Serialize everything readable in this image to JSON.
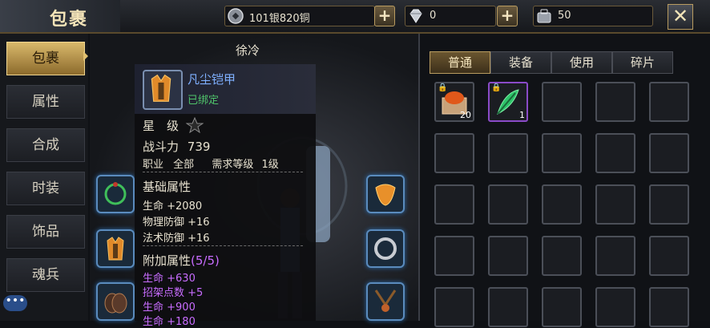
{
  "title": "包裹",
  "resources": [
    {
      "icon": "silver-coin-icon",
      "value": "101银820铜"
    },
    {
      "icon": "diamond-icon",
      "value": "0"
    },
    {
      "icon": "bag-icon",
      "value": "50"
    }
  ],
  "sidebar": {
    "tabs": [
      "包裹",
      "属性",
      "合成",
      "时装",
      "饰品",
      "魂兵"
    ],
    "active": 0
  },
  "character": {
    "name": "徐冷"
  },
  "tooltip": {
    "name": "凡尘铠甲",
    "bound": "已绑定",
    "star_label": "星　级",
    "power_label": "战斗力",
    "power_value": "739",
    "job_label": "职业",
    "job_value": "全部",
    "level_label": "需求等级",
    "level_value": "1级",
    "base_title": "基础属性",
    "base_stats": [
      "生命 +2080",
      "物理防御 +16",
      "法术防御 +16"
    ],
    "extra_title": "附加属性",
    "extra_count": "(5/5)",
    "extra_stats": [
      "生命 +630",
      "招架点数 +5",
      "生命 +900",
      "生命 +180"
    ]
  },
  "rightpanel": {
    "tabs": [
      "普通",
      "装备",
      "使用",
      "碎片"
    ],
    "active": 0,
    "items": [
      {
        "icon": "chest-icon",
        "count": "20",
        "locked": true
      },
      {
        "icon": "feather-icon",
        "count": "1",
        "locked": true
      }
    ]
  },
  "chat_icon": "chat-bubble-icon",
  "colors": {
    "gold": "#d9b96b",
    "purple": "#c86cff",
    "green": "#5bd65b",
    "blue": "#7fb0ff"
  }
}
